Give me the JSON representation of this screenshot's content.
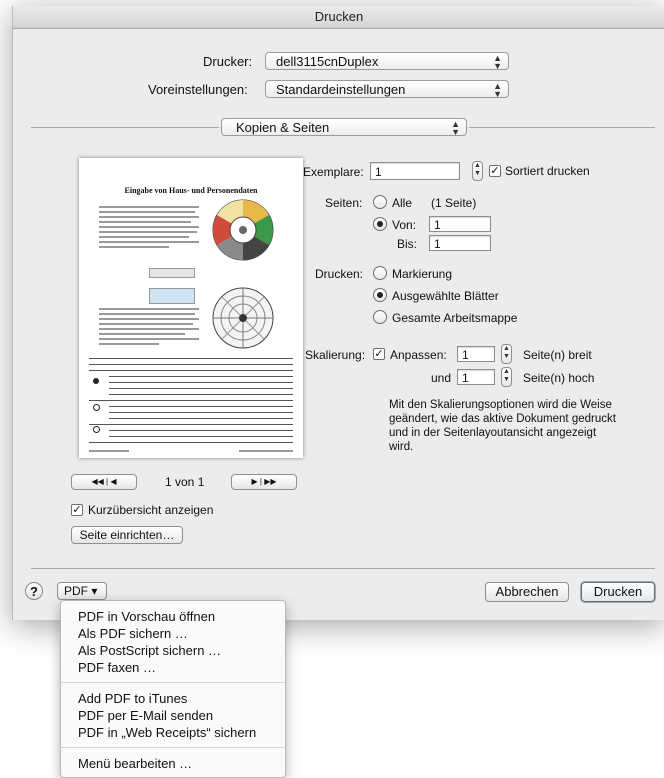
{
  "window": {
    "title": "Drucken"
  },
  "printer": {
    "label": "Drucker:",
    "value": "dell3115cnDuplex"
  },
  "presets": {
    "label": "Voreinstellungen:",
    "value": "Standardeinstellungen"
  },
  "section": {
    "value": "Kopien & Seiten"
  },
  "copies": {
    "label": "Exemplare:",
    "value": "1",
    "collate_label": "Sortiert drucken",
    "collate_checked": true
  },
  "pages": {
    "label": "Seiten:",
    "all_label": "Alle",
    "all_hint": "(1 Seite)",
    "from_label": "Von:",
    "from_value": "1",
    "to_label": "Bis:",
    "to_value": "1",
    "selected": "from"
  },
  "print_what": {
    "label": "Drucken:",
    "options": [
      "Markierung",
      "Ausgewählte Blätter",
      "Gesamte Arbeitsmappe"
    ],
    "selected": "Ausgewählte Blätter"
  },
  "scaling": {
    "label": "Skalierung:",
    "fit_label": "Anpassen:",
    "fit_checked": true,
    "width_value": "1",
    "width_unit": "Seite(n) breit",
    "and_label": "und",
    "height_value": "1",
    "height_unit": "Seite(n) hoch",
    "note": "Mit den Skalierungsoptionen wird die Weise geändert, wie das aktive Dokument gedruckt und in der Seitenlayoutansicht angezeigt wird."
  },
  "preview": {
    "doc_title": "Eingabe von Haus- und Personendaten",
    "page_indicator": "1 von 1",
    "nav_first": "◀◀",
    "nav_prev": "◀",
    "nav_next": "▶",
    "nav_last": "▶▶"
  },
  "quick_preview": {
    "label": "Kurzübersicht anzeigen",
    "checked": true
  },
  "page_setup_button": "Seite einrichten…",
  "help_button": "?",
  "pdf_button": "PDF ▾",
  "cancel_button": "Abbrechen",
  "print_button": "Drucken",
  "pdf_menu": {
    "group1": [
      "PDF in Vorschau öffnen",
      "Als PDF sichern …",
      "Als PostScript sichern …",
      "PDF faxen …"
    ],
    "group2": [
      "Add PDF to iTunes",
      "PDF per E-Mail senden",
      "PDF in „Web Receipts“ sichern"
    ],
    "group3": [
      "Menü bearbeiten …"
    ]
  },
  "icons": {
    "popup_arrows": "up-down-chevron-icon",
    "checkmark": "checkmark-icon",
    "help": "question-mark-icon"
  }
}
